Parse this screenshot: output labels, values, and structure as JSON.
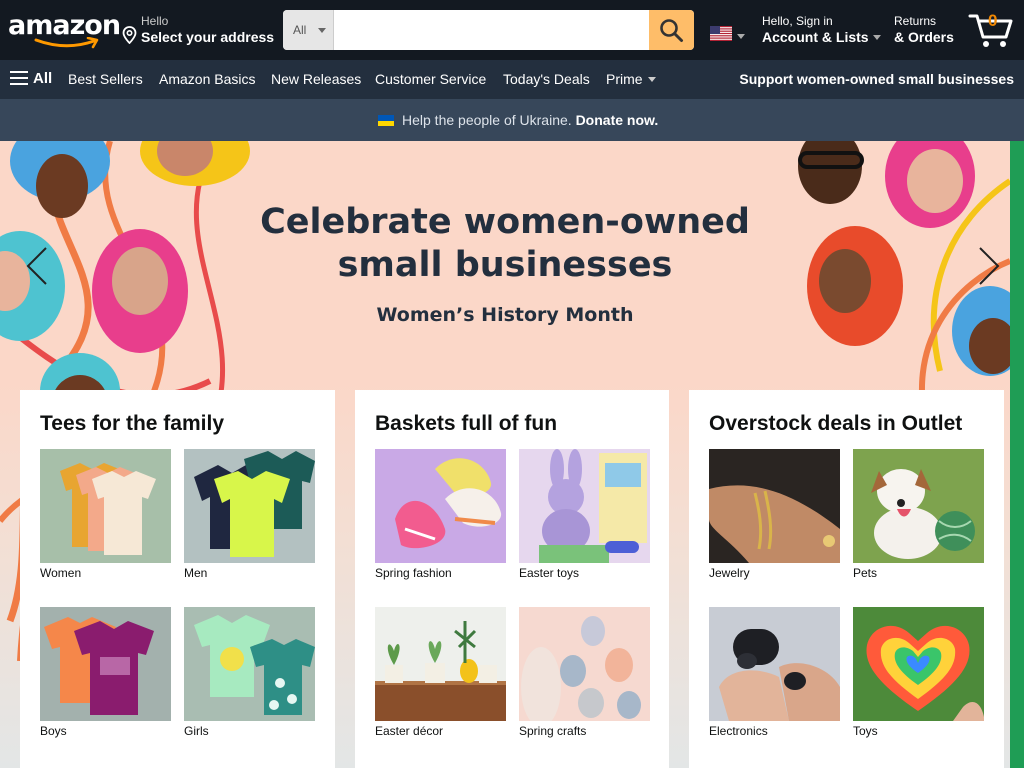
{
  "header": {
    "logo": "amazon",
    "address_line1": "Hello",
    "address_line2": "Select your address",
    "search_category": "All",
    "search_placeholder": "",
    "account_line1": "Hello, Sign in",
    "account_line2": "Account & Lists",
    "orders_line1": "Returns",
    "orders_line2": "& Orders",
    "cart_count": "0"
  },
  "subnav": {
    "all": "All",
    "items": [
      "Best Sellers",
      "Amazon Basics",
      "New Releases",
      "Customer Service",
      "Today's Deals",
      "Prime"
    ],
    "promo": "Support women-owned small businesses"
  },
  "ukraine_bar": {
    "text": "Help the people of Ukraine.",
    "link": "Donate now."
  },
  "hero": {
    "title": "Celebrate women-owned small businesses",
    "subtitle": "Women’s History Month"
  },
  "cards": [
    {
      "title": "Tees for the family",
      "tiles": [
        "Women",
        "Men",
        "Boys",
        "Girls"
      ]
    },
    {
      "title": "Baskets full of fun",
      "tiles": [
        "Spring fashion",
        "Easter toys",
        "Easter décor",
        "Spring crafts"
      ]
    },
    {
      "title": "Overstock deals in Outlet",
      "tiles": [
        "Jewelry",
        "Pets",
        "Electronics",
        "Toys"
      ]
    }
  ],
  "colors": {
    "nav_dark": "#131921",
    "nav_sub": "#232f3e",
    "ukraine_bar": "#37475a",
    "search_button": "#febd69",
    "cart_count": "#f08804",
    "hero_bg": "#fbd7c8"
  },
  "icons": {
    "logo_smile": "amazon-smile-icon",
    "location": "location-pin-icon",
    "search": "search-icon",
    "flag": "us-flag-icon",
    "cart": "cart-icon",
    "menu": "hamburger-icon",
    "ukraine_flag": "ukraine-flag-icon",
    "prev": "chevron-left-icon",
    "next": "chevron-right-icon"
  }
}
